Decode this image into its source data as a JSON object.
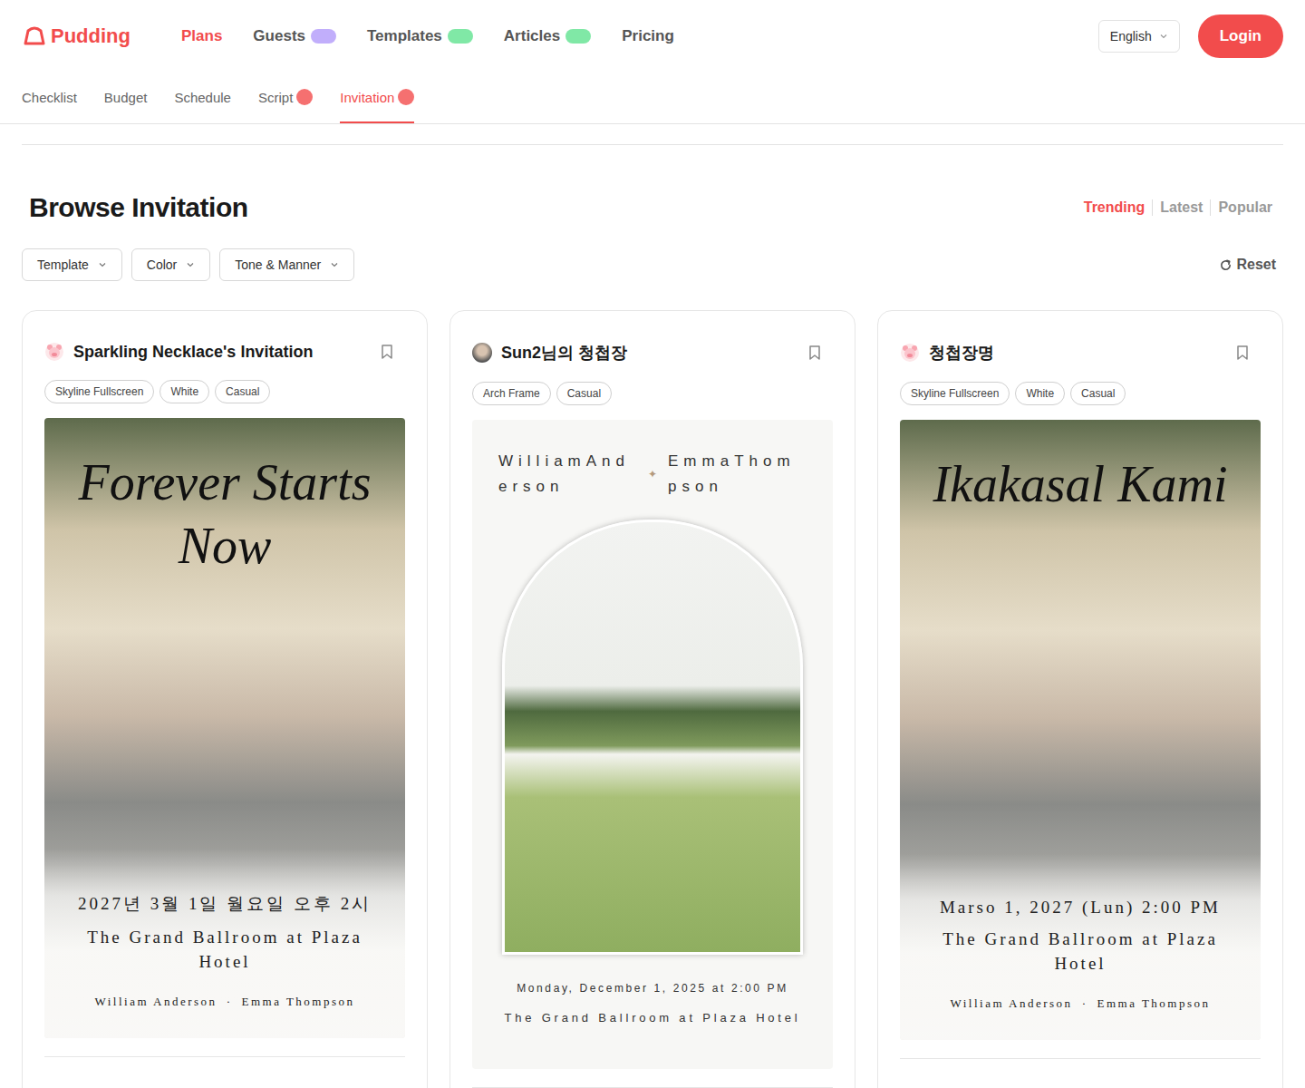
{
  "brand": {
    "name": "Pudding"
  },
  "nav": [
    {
      "label": "Plans",
      "selected": true,
      "badge": false,
      "color": "#f24c4c"
    },
    {
      "label": "Guests",
      "selected": false,
      "badge": true,
      "color": "#a78bfa"
    },
    {
      "label": "Templates",
      "selected": false,
      "badge": true,
      "color": "#4ade80"
    },
    {
      "label": "Articles",
      "selected": false,
      "badge": true,
      "color": "#4ade80"
    },
    {
      "label": "Pricing",
      "selected": false,
      "badge": false,
      "color": "#999999"
    }
  ],
  "sub_nav": [
    {
      "label": "Checklist",
      "selected": false,
      "badge": false
    },
    {
      "label": "Budget",
      "selected": false,
      "badge": false
    },
    {
      "label": "Schedule",
      "selected": false,
      "badge": false
    },
    {
      "label": "Script",
      "selected": false,
      "badge": true
    },
    {
      "label": "Invitation",
      "selected": true,
      "badge": true
    }
  ],
  "language": {
    "label": "English"
  },
  "login": {
    "label": "Login"
  },
  "page": {
    "title": "Browse Invitation"
  },
  "sort": [
    {
      "label": "Trending",
      "selected": true
    },
    {
      "label": "Latest",
      "selected": false
    },
    {
      "label": "Popular",
      "selected": false
    }
  ],
  "filters": [
    "Template",
    "Color",
    "Tone & Manner"
  ],
  "reset": {
    "label": "Reset"
  },
  "cards": [
    {
      "title": "Sparkling Necklace's Invitation",
      "avatar": "pig",
      "tags": [
        "Skyline Fullscreen",
        "White",
        "Casual"
      ],
      "preview": {
        "kind": "fullscreen",
        "headline": "Forever Starts Now",
        "date": "2027년 3월 1일 월요일 오후 2시",
        "venue": "The Grand Ballroom at Plaza Hotel",
        "groom": "William Anderson",
        "separator": "·",
        "bride": "Emma Thompson"
      }
    },
    {
      "title": "Sun2님의 청첩장",
      "avatar": "photo",
      "tags": [
        "Arch Frame",
        "Casual"
      ],
      "preview": {
        "kind": "arch",
        "headline": "",
        "date": "Monday, December 1, 2025 at 2:00 PM",
        "venue": "The Grand Ballroom at Plaza Hotel",
        "groom": "WilliamAnderson",
        "separator": "✦",
        "bride": "EmmaThompson"
      }
    },
    {
      "title": "청첩장명",
      "avatar": "pig",
      "tags": [
        "Skyline Fullscreen",
        "White",
        "Casual"
      ],
      "preview": {
        "kind": "fullscreen",
        "headline": "Ikakasal Kami",
        "date": "Marso 1, 2027 (Lun) 2:00 PM",
        "venue": "The Grand Ballroom at Plaza Hotel",
        "groom": "William Anderson",
        "separator": "·",
        "bride": "Emma Thompson"
      }
    }
  ]
}
